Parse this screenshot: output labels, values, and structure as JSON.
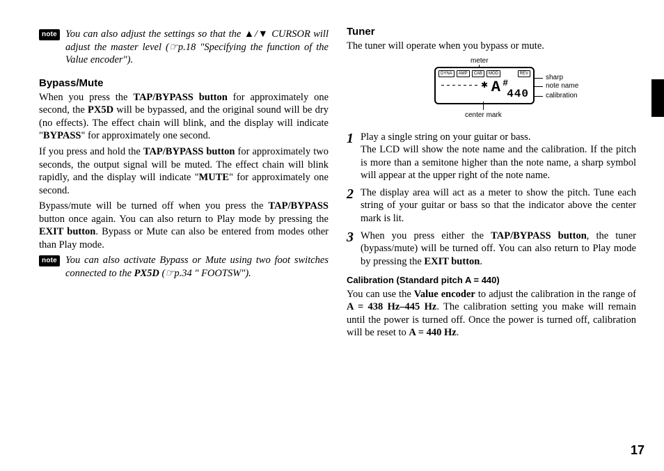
{
  "page_number": "17",
  "note_label": "note",
  "left": {
    "note1_a": "You can also adjust the settings so that the ",
    "note1_b": " CUR­SOR will adjust the master level (",
    "note1_c": "p.18 \"Specifying the function of the Value encoder\").",
    "bypass_heading": "Bypass/Mute",
    "p1_a": "When you press the ",
    "p1_b": "TAP/BYPASS button",
    "p1_c": " for approxi­mately one second, the ",
    "p1_d": "PX5D",
    "p1_e": " will be bypassed, and the original sound will be dry (no effects). The effect chain will blink, and the display will indicate \"",
    "p1_f": "BYPASS",
    "p1_g": "\" for approximately one second.",
    "p2_a": "If you press and hold the ",
    "p2_b": "TAP/BYPASS button",
    "p2_c": " for ap­proximately two seconds, the output signal will be mut­ed. The effect chain will blink rapidly, and the display will indicate \"",
    "p2_d": "MUTE",
    "p2_e": "\" for approximately one second.",
    "p3_a": "Bypass/mute will be turned off when you press the ",
    "p3_b": "TAP/BYPASS",
    "p3_c": " button once again. You can also return to Play mode by pressing the ",
    "p3_d": "EXIT button",
    "p3_e": ". Bypass or Mute can also be entered from modes other than Play mode.",
    "note2_a": "You can also activate Bypass or Mute using two foot switches connected to the ",
    "note2_b": "PX5D",
    "note2_c": " (",
    "note2_d": "p.34 \" FOOTSW\")."
  },
  "right": {
    "tuner_heading": "Tuner",
    "intro": "The tuner will operate when you bypass or mute.",
    "fig": {
      "meter": "meter",
      "sharp": "sharp",
      "note_name": "note name",
      "calibration": "calibration",
      "center_mark": "center mark",
      "tabs": [
        "DYNA",
        "AMP",
        "CAB",
        "MOD"
      ],
      "rev": "REV",
      "note": "A",
      "sharp_sym": "#",
      "cal": "440"
    },
    "steps": {
      "s1a": "Play a single string on your guitar or bass.",
      "s1b": "The LCD will show the note name and the calibra­tion. If the pitch is more than a semitone higher than the note name, a sharp symbol will appear at the upper right of the note name.",
      "s2": "The display area will act as a meter to show the pitch. Tune each string of your guitar or bass so that the indicator above the center mark is lit.",
      "s3a": "When you press either the ",
      "s3b": "TAP/BYPASS button",
      "s3c": ", the tuner (bypass/mute) will be turned off. You can also return to Play mode by pressing the ",
      "s3d": "EXIT button",
      "s3e": "."
    },
    "cal_heading": "Calibration (Standard pitch A = 440)",
    "cal_p_a": "You can use the ",
    "cal_p_b": "Value encoder",
    "cal_p_c": " to adjust the calibration in the range of ",
    "cal_p_d": "A = 438 Hz–445 Hz",
    "cal_p_e": ". The calibration set­ting you make will remain until the power is turned off. Once the power is turned off, calibration will be reset to ",
    "cal_p_f": "A = 440 Hz",
    "cal_p_g": "."
  }
}
